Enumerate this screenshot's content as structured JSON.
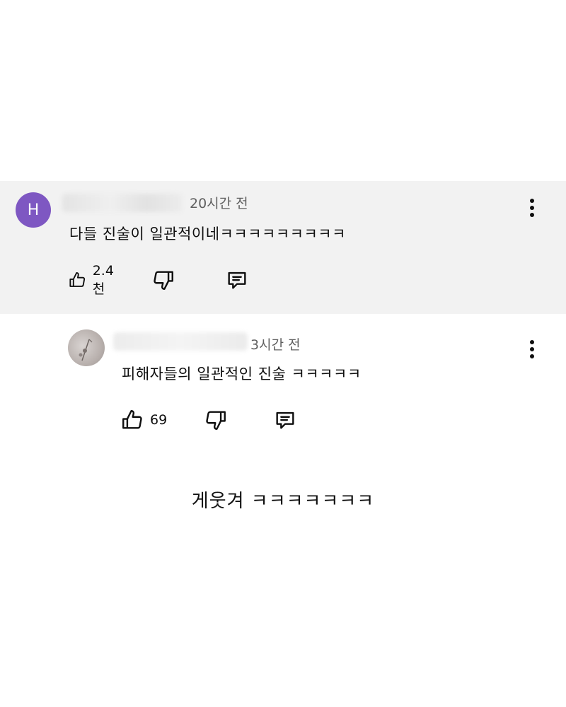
{
  "comments": [
    {
      "avatar_initial": "H",
      "time": "20시간 전",
      "text": "다들 진술이 일관적이네ㅋㅋㅋㅋㅋㅋㅋㅋㅋ",
      "likes": "2.4천"
    },
    {
      "time": "3시간 전",
      "text": "피해자들의 일관적인 진술 ㅋㅋㅋㅋㅋ",
      "likes": "69"
    }
  ],
  "caption": "게웃겨 ㅋㅋㅋㅋㅋㅋㅋ",
  "colors": {
    "avatar_h": "#7e57c2",
    "highlight_bg": "#f2f2f2",
    "meta_text": "#606060"
  },
  "icons": [
    "thumbs-up-icon",
    "thumbs-down-icon",
    "reply-icon",
    "more-vert-icon"
  ]
}
